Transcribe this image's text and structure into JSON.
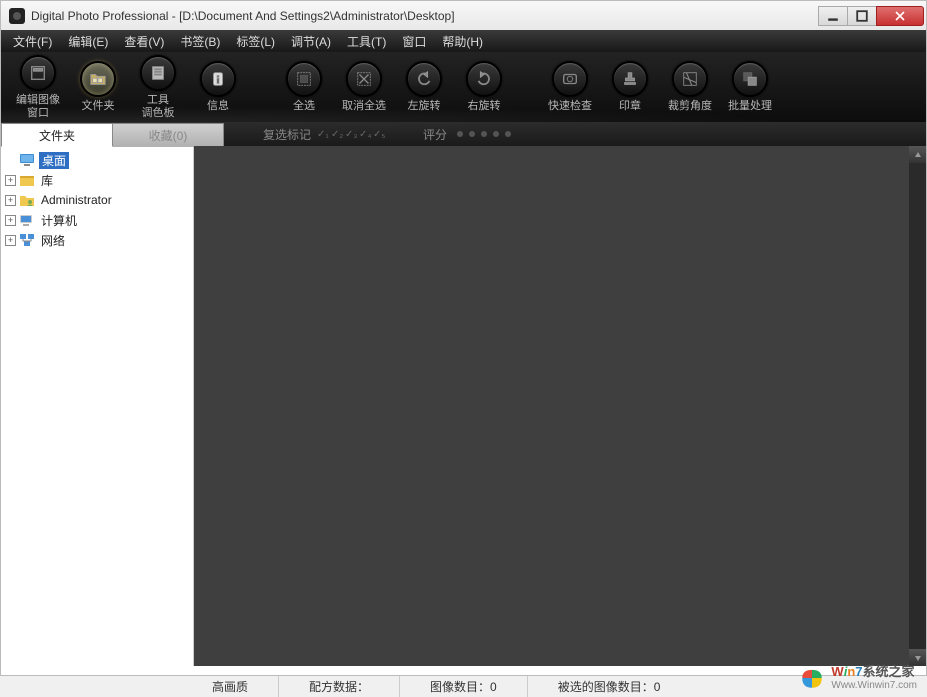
{
  "title": "Digital Photo Professional - [D:\\Document And Settings2\\Administrator\\Desktop]",
  "menu": {
    "file": "文件(F)",
    "edit": "编辑(E)",
    "view": "查看(V)",
    "bookmark": "书签(B)",
    "label": "标签(L)",
    "adjust": "调节(A)",
    "tools": "工具(T)",
    "window": "窗口",
    "help": "帮助(H)"
  },
  "toolbar": {
    "edit_image_window": "编辑图像\n窗口",
    "folder": "文件夹",
    "tool_palette": "工具\n调色板",
    "info": "信息",
    "select_all": "全选",
    "deselect_all": "取消全选",
    "rotate_left": "左旋转",
    "rotate_right": "右旋转",
    "quick_check": "快速检查",
    "stamp": "印章",
    "trim_angle": "裁剪角度",
    "batch": "批量处理"
  },
  "tabs": {
    "folder": "文件夹",
    "favorites": "收藏(0)"
  },
  "filter": {
    "multi_select": "复选标记",
    "rating": "评分"
  },
  "tree": {
    "desktop": "桌面",
    "library": "库",
    "admin": "Administrator",
    "computer": "计算机",
    "network": "网络"
  },
  "status": {
    "hq": "高画质",
    "recipe": "配方数据：",
    "count": "图像数目：0",
    "selected": "被选的图像数目：0"
  },
  "watermark": {
    "brand_rest": "系统之家",
    "url": "Www.Winwin7.com"
  }
}
